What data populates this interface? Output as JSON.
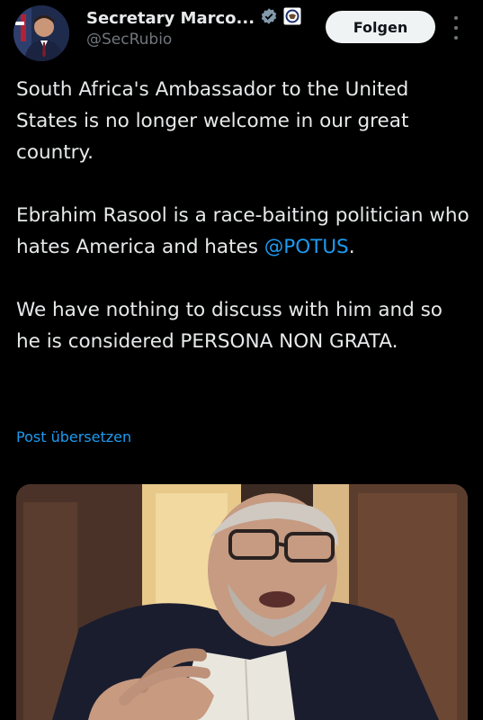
{
  "author": {
    "display_name": "Secretary Marco...",
    "handle": "@SecRubio",
    "verified_icon": "verified-badge-icon",
    "affiliation_icon": "state-department-seal-icon"
  },
  "follow_button": {
    "label": "Folgen"
  },
  "more_icon": "more-vertical-icon",
  "tweet": {
    "para1": "South Africa's Ambassador to the United States is no longer welcome in our great country.",
    "para2_text": "Ebrahim Rasool is a race-baiting politician who hates America and hates ",
    "para2_mention": "@POTUS",
    "para2_end": ".",
    "para3": "We have nothing to discuss with him and so he is considered PERSONA NON GRATA."
  },
  "translate_link": "Post übersetzen",
  "colors": {
    "background": "#000000",
    "text": "#e7e9ea",
    "muted": "#71767b",
    "link": "#1d9bf0",
    "verified": "#829aab"
  }
}
